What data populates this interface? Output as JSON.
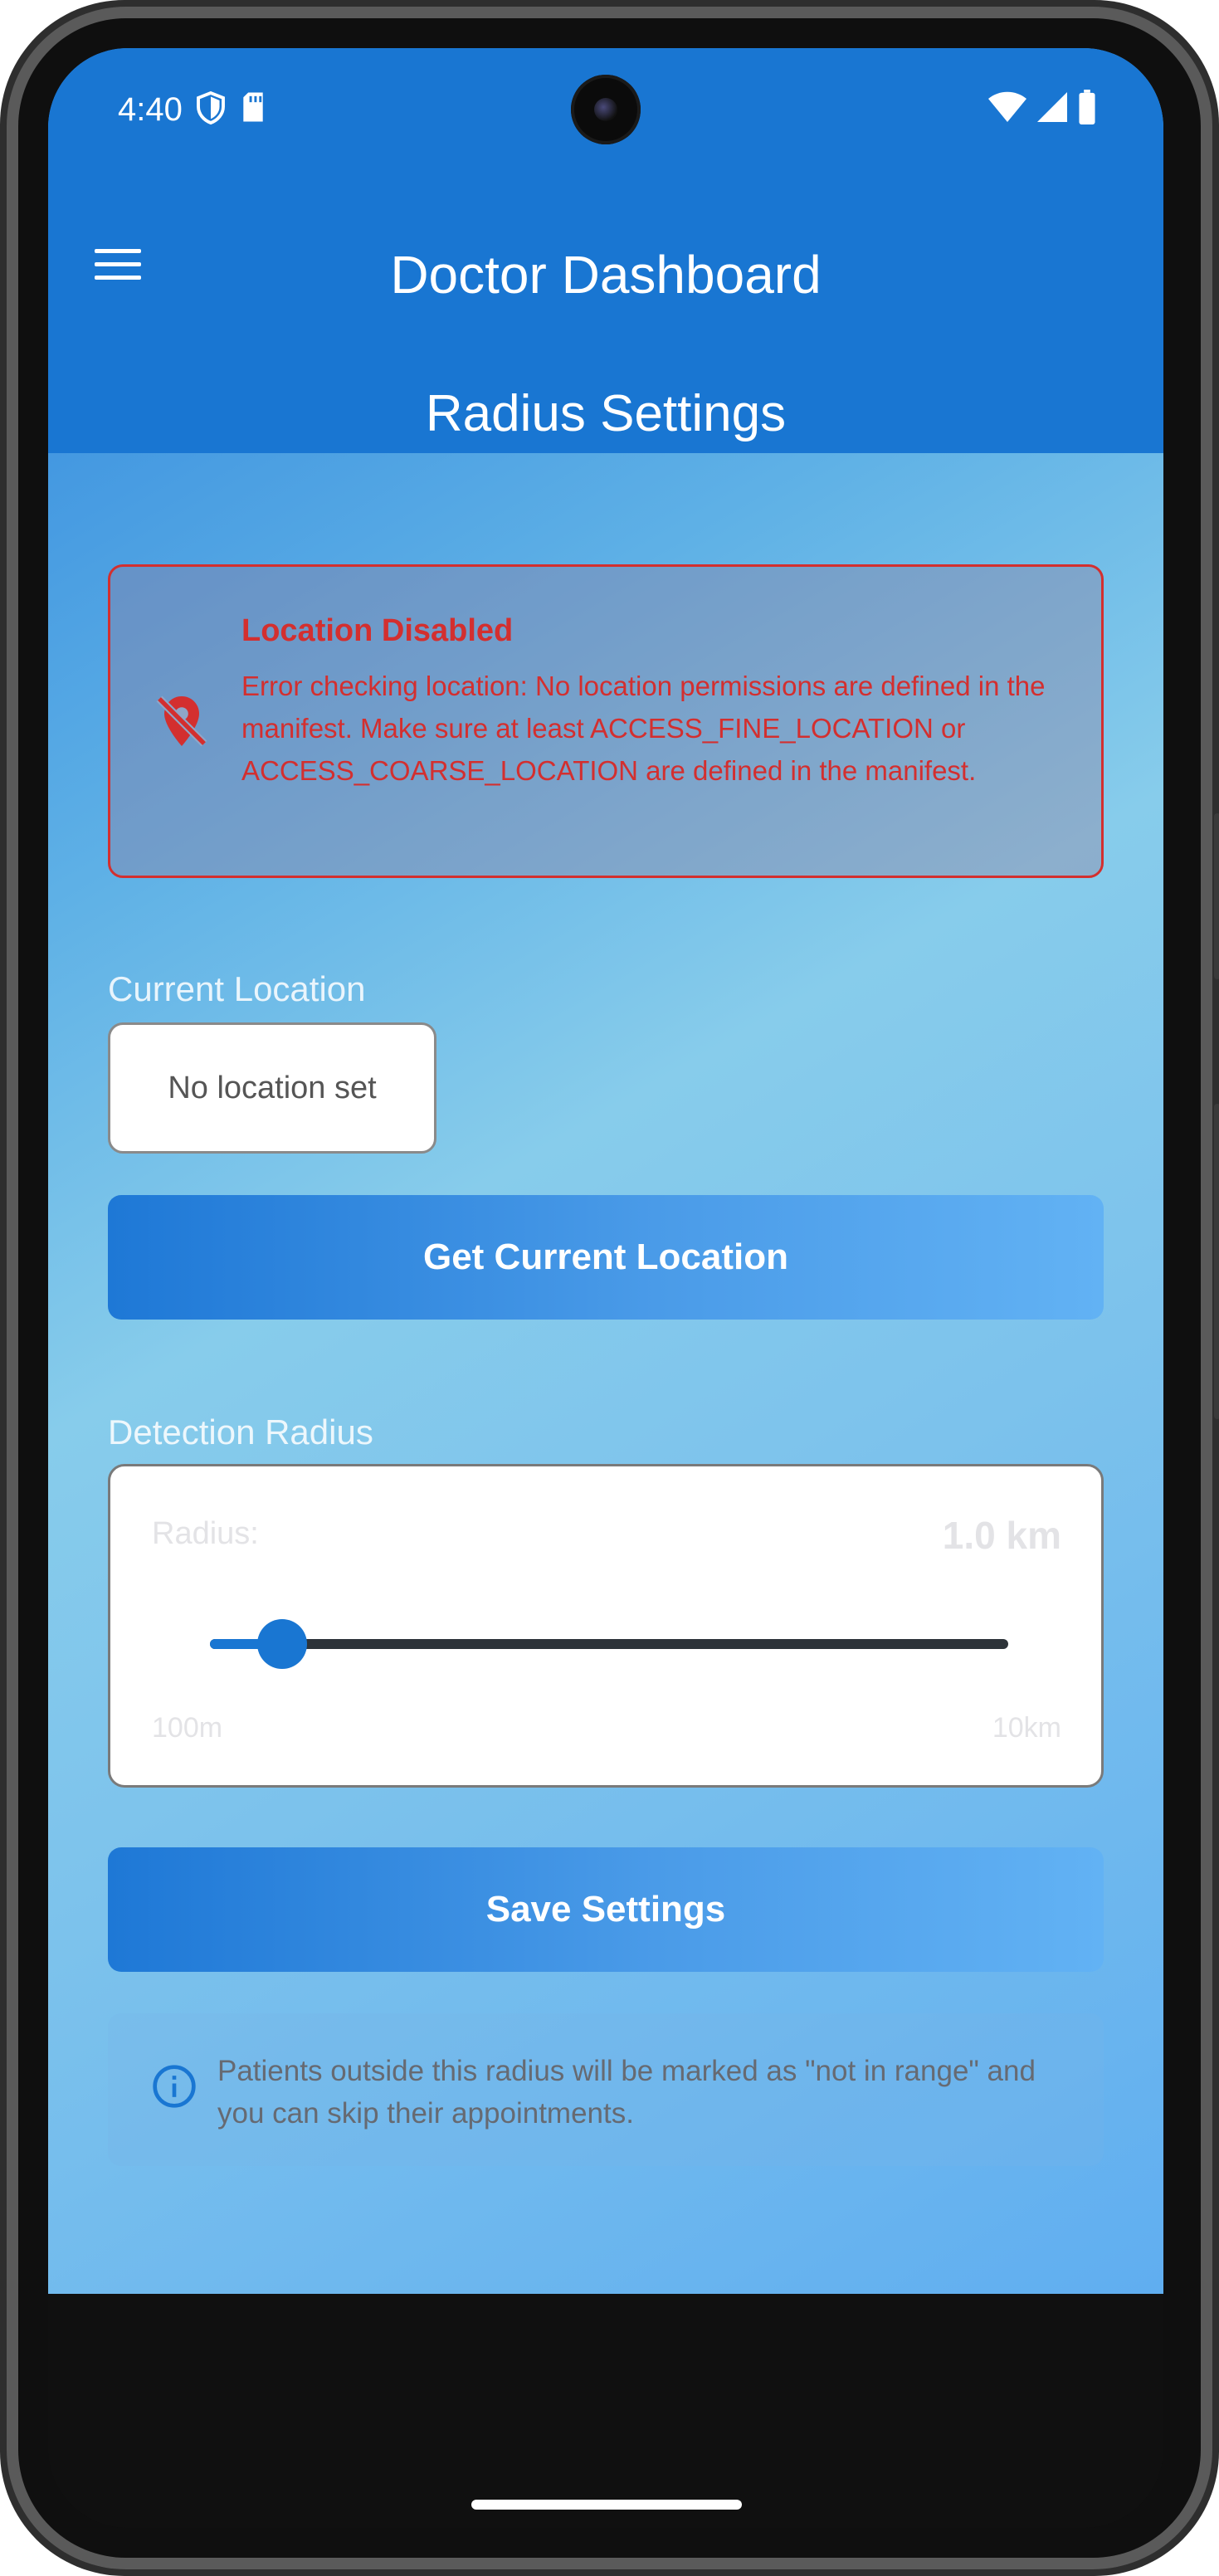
{
  "status_bar": {
    "time": "4:40",
    "left_icons": [
      "shield-icon",
      "sd-card-icon"
    ],
    "right_icons": [
      "wifi-icon",
      "signal-icon",
      "battery-icon"
    ]
  },
  "app_bar": {
    "title": "Doctor Dashboard",
    "menu_icon": "menu-icon"
  },
  "page": {
    "title": "Radius Settings"
  },
  "alert": {
    "icon": "location-off-icon",
    "title": "Location Disabled",
    "message": "Error checking location: No location permissions are defined in the manifest. Make sure at least ACCESS_FINE_LOCATION or ACCESS_COARSE_LOCATION are defined in the manifest.",
    "color": "#d32f2f"
  },
  "current_location": {
    "label": "Current Location",
    "value": "No location set",
    "button_label": "Get Current Location"
  },
  "detection_radius": {
    "label": "Detection Radius",
    "field_label": "Radius:",
    "value_display": "1.0 km",
    "value_km": 1.0,
    "min_label": "100m",
    "max_label": "10km",
    "min_km": 0.1,
    "max_km": 10
  },
  "save_button_label": "Save Settings",
  "info": {
    "icon": "info-icon",
    "text": "Patients outside this radius will be marked as \"not in range\" and you can skip their appointments."
  },
  "colors": {
    "primary": "#1976d2",
    "error": "#d32f2f"
  }
}
